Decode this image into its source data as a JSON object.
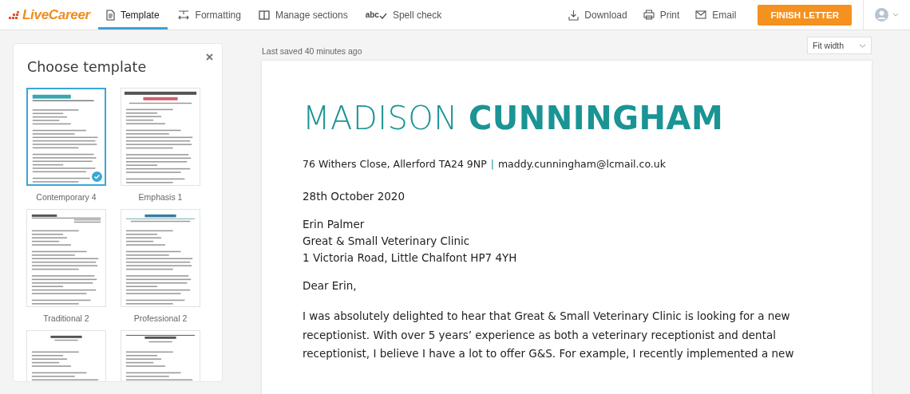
{
  "header": {
    "logo": "LiveCareer",
    "tabs": [
      {
        "label": "Template",
        "kind": "document",
        "selected": true
      },
      {
        "label": "Formatting",
        "kind": "format",
        "selected": false
      },
      {
        "label": "Manage sections",
        "kind": "columns",
        "selected": false
      },
      {
        "label": "Spell check",
        "kind": "abc",
        "selected": false
      }
    ],
    "spell_icon_text": "abc",
    "actions": [
      {
        "label": "Download",
        "kind": "download"
      },
      {
        "label": "Print",
        "kind": "print"
      },
      {
        "label": "Email",
        "kind": "email"
      }
    ],
    "finish_button": "FINISH LETTER"
  },
  "template_panel": {
    "title": "Choose template",
    "templates": [
      {
        "name": "Contemporary 4",
        "selected": true
      },
      {
        "name": "Emphasis 1",
        "selected": false
      },
      {
        "name": "Traditional 2",
        "selected": false
      },
      {
        "name": "Professional 2",
        "selected": false
      },
      {
        "selected": false
      },
      {
        "selected": false
      }
    ]
  },
  "status": "Last saved 40 minutes ago",
  "zoom_select": {
    "value": "Fit width"
  },
  "letter": {
    "name": "MADISON **CUNNINGHAM**",
    "address": "76 Withers Close, Allerford TA24 9NP",
    "separator": "|",
    "email": "maddy.cunningham@lcmail.co.uk",
    "date": "28th October 2020",
    "recipient": [
      "Erin Palmer",
      "Great & Small Veterinary Clinic",
      "1 Victoria Road, Little Chalfont HP7 4YH"
    ],
    "salutation": "Dear Erin,",
    "body": "I was absolutely delighted to hear that Great & Small Veterinary Clinic is looking for a new receptionist. With over 5 years’ experience as both a veterinary receptionist and dental receptionist, I believe I have a lot to offer G&S. For example, I recently implemented a new"
  }
}
